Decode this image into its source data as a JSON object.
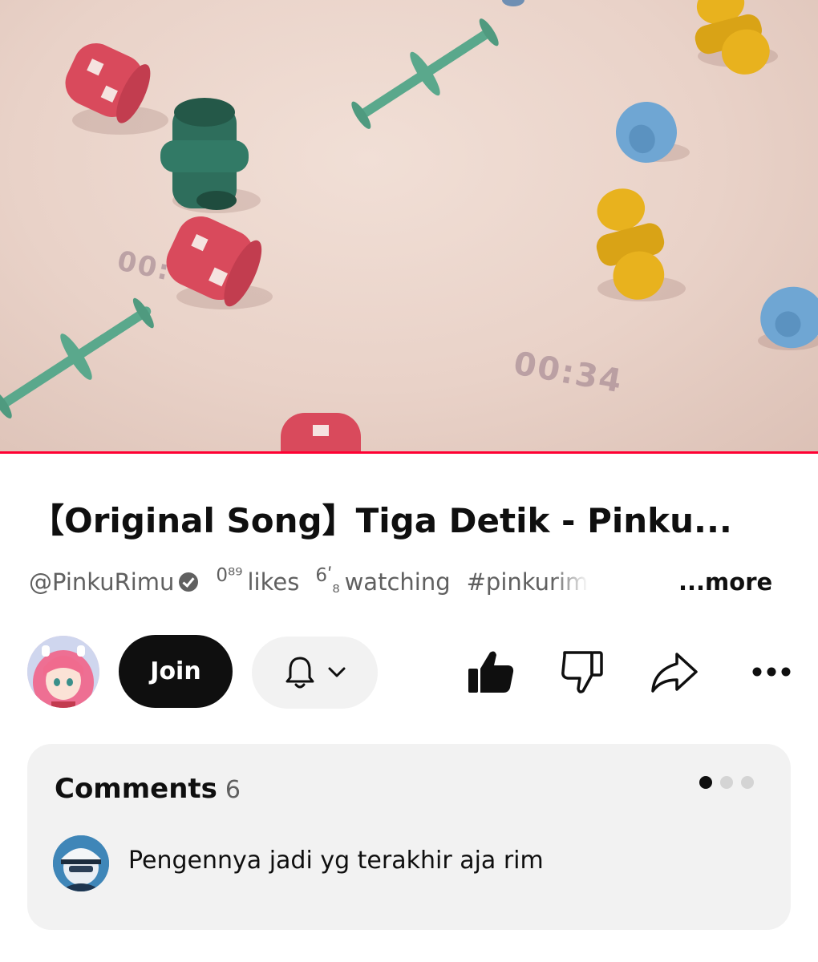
{
  "video": {
    "overlay_timers": [
      "00:34",
      "00:"
    ],
    "progress_fraction": 1.0
  },
  "info": {
    "title": "【Original Song】Tiga Detik - Pinku...",
    "channel_handle": "@PinkuRimu",
    "likes_ticker_top": "0⁸⁹",
    "likes_ticker_bottom": "",
    "likes_label": "likes",
    "watching_ticker_top": "6ʹ",
    "watching_ticker_bottom": "₈",
    "watching_label": "watching",
    "hashtag": "#pinkurimu",
    "more_label": "...more"
  },
  "actions": {
    "join_label": "Join"
  },
  "comments": {
    "heading": "Comments",
    "count": "6",
    "dots_total": 3,
    "dots_active": 0,
    "first_comment_text": "Pengennya jadi yg terakhir aja rim"
  },
  "colors": {
    "accent": "#ff0033",
    "text_primary": "#0f0f0f",
    "text_secondary": "#606060",
    "chip_bg": "#f2f2f2"
  },
  "icons": [
    "verified-badge-icon",
    "bell-icon",
    "chevron-down-icon",
    "thumbs-up-icon",
    "thumbs-down-icon",
    "share-icon",
    "more-options-icon"
  ]
}
